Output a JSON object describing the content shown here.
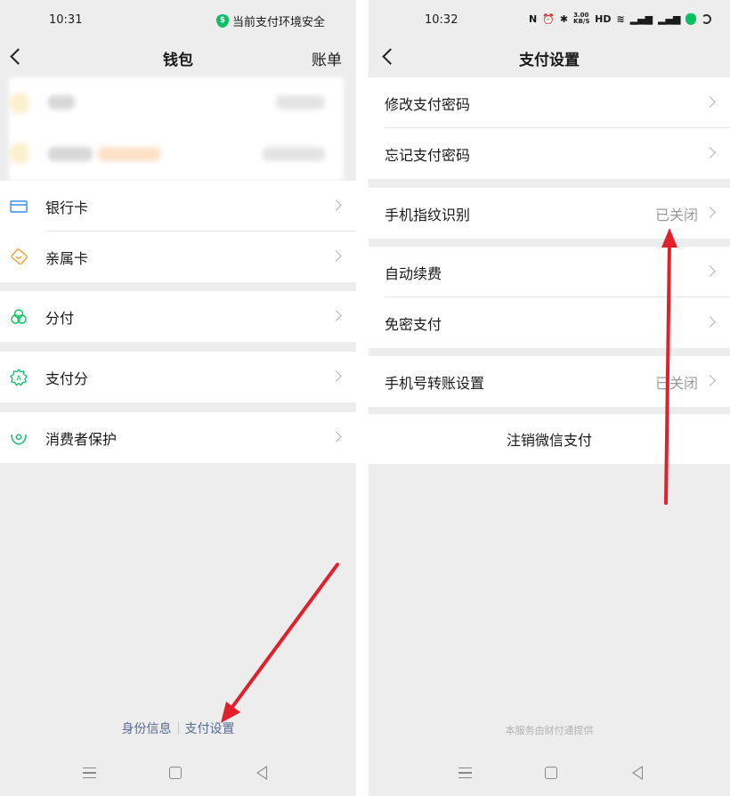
{
  "left": {
    "status": {
      "time": "10:31",
      "secure_text": "当前支付环境安全"
    },
    "nav": {
      "title": "钱包",
      "right": "账单"
    },
    "menu": [
      {
        "label": "银行卡",
        "icon": "bank-card-icon",
        "color": "#3a8ee6"
      },
      {
        "label": "亲属卡",
        "icon": "family-card-icon",
        "color": "#f0a030"
      },
      {
        "label": "分付",
        "icon": "fenfu-icon",
        "color": "#07c160"
      },
      {
        "label": "支付分",
        "icon": "pay-score-icon",
        "color": "#07c160"
      },
      {
        "label": "消费者保护",
        "icon": "consumer-protection-icon",
        "color": "#07c160"
      }
    ],
    "footer": {
      "identity": "身份信息",
      "pay_settings": "支付设置"
    }
  },
  "right": {
    "status": {
      "time": "10:32",
      "speed": "3.00 KB/S"
    },
    "nav": {
      "title": "支付设置"
    },
    "items": [
      {
        "label": "修改支付密码"
      },
      {
        "label": "忘记支付密码"
      },
      {
        "label": "手机指纹识别",
        "value": "已关闭"
      },
      {
        "label": "自动续费"
      },
      {
        "label": "免密支付"
      },
      {
        "label": "手机号转账设置",
        "value": "已关闭"
      }
    ],
    "cancel": "注销微信支付",
    "provided_by": "本服务由财付通提供"
  },
  "annotation_color": "#e0202a"
}
